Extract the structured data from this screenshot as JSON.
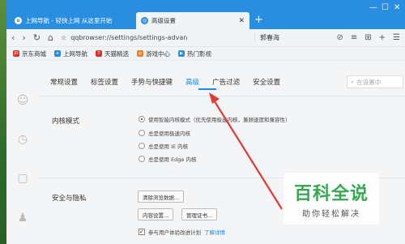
{
  "tabs": [
    {
      "title": "上网导航 - 轻快上网 从这里开始",
      "fav": "e"
    },
    {
      "title": "高级设置",
      "fav": "◎"
    }
  ],
  "window": {
    "minimize": "—",
    "maximize": "☐",
    "close": "✕"
  },
  "nav": {
    "back": "‹",
    "forward": "›",
    "reload": "↻",
    "home": "⌂",
    "star": "☆",
    "url": "qqbrowser://settings/settings-advan",
    "user": "郭春海",
    "right_icons": [
      "⊘",
      "≡",
      "⊞",
      "+",
      "☰"
    ]
  },
  "bookmarks": [
    {
      "label": "京东商城",
      "color": "#d9312b",
      "glyph": "JD"
    },
    {
      "label": "上网导航",
      "color": "#2a8ee0",
      "glyph": "e"
    },
    {
      "label": "天猫精选",
      "color": "#d9312b",
      "glyph": "T"
    },
    {
      "label": "游戏中心",
      "color": "#e67e22",
      "glyph": "◎"
    },
    {
      "label": "热门影视",
      "color": "#2a8ee0",
      "glyph": "▶"
    }
  ],
  "settings": {
    "tabs": [
      "常规设置",
      "标签设置",
      "手势与快捷键",
      "高级",
      "广告过滤",
      "安全设置"
    ],
    "selected_tab": "高级",
    "search_placeholder": "在设置中"
  },
  "kernel": {
    "title": "内核模式",
    "options": [
      {
        "label": "使用智能内核模式（优先使用极速内核，兼顾速度和兼容性）",
        "selected": true
      },
      {
        "label": "总是使用极速内核",
        "selected": false
      },
      {
        "label": "总是使用 IE 内核",
        "selected": false
      },
      {
        "label": "总是使用 Edge 内核",
        "selected": false
      }
    ]
  },
  "privacy": {
    "title": "安全与隐私",
    "clear_button": "清除浏览数据...",
    "content_button": "内容设置...",
    "cert_button": "管理证书...",
    "ux_label": "参与用户体验改进计划",
    "ux_link": "了解详情",
    "ux_checked": true
  },
  "watermark": {
    "title": "百科全说",
    "subtitle": "助你轻松解决"
  },
  "colors": {
    "accent": "#1e88e5",
    "tabstrip": "#2a8ee0",
    "arrow": "#e53935"
  }
}
